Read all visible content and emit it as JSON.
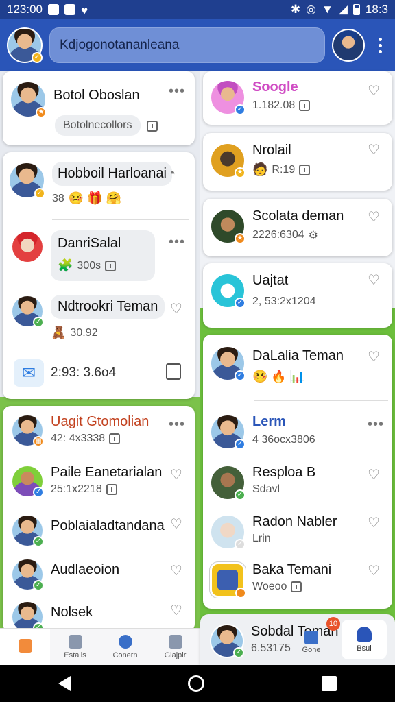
{
  "status_bar": {
    "time": "123:00",
    "clock_right": "18:3"
  },
  "header": {
    "search_text": "Kdjogonotananleana"
  },
  "left_column": {
    "card1": {
      "name": "Botol Oboslan",
      "chip": "Botolnecollors"
    },
    "card2": {
      "items": [
        {
          "name": "Hobboil Harloanai",
          "emojis": "🤒 🎁 🤗",
          "count": "38"
        },
        {
          "name": "DanriSalal",
          "sub": "300s"
        },
        {
          "name": "Ndtrookri Teman",
          "sub": "30.92"
        },
        {
          "name": "2:93: 3.6o4"
        }
      ]
    },
    "card3": {
      "items": [
        {
          "name": "Uagit Gtomolian",
          "sub": "42: 4x3338"
        },
        {
          "name": "Paile Eanetarialan",
          "sub": "25:1x2218"
        },
        {
          "name": "Poblaialadtandana"
        },
        {
          "name": "Audlaeoion"
        },
        {
          "name": "Nolsek"
        }
      ]
    }
  },
  "right_column": {
    "items": [
      {
        "name": "Soogle",
        "sub": "1.182.08"
      },
      {
        "name": "Nrolail",
        "sub": "R:19"
      },
      {
        "name": "Scolata deman",
        "sub": "2226:6304"
      },
      {
        "name": "Uajtat",
        "sub": "2, 53:2x1204"
      },
      {
        "name": "DaLalia Teman",
        "emojis": "🤒 🔥 📊"
      },
      {
        "name": "Lerm",
        "sub": "4 36ocx3806"
      },
      {
        "name": "Resploa B",
        "sub": "Sdavl"
      },
      {
        "name": "Radon Nabler",
        "sub": "Lrin"
      },
      {
        "name": "Baka Temani",
        "sub": "Woeoo"
      },
      {
        "name": "Sobdal Teman",
        "sub": "6.53175",
        "badge": "10"
      }
    ],
    "bottom_tabs": [
      {
        "label": "Gone"
      },
      {
        "label": "Bsul"
      }
    ]
  },
  "tab_bar": {
    "tabs": [
      {
        "label": ""
      },
      {
        "label": "Estalls"
      },
      {
        "label": "Conern"
      },
      {
        "label": "Glajpir"
      }
    ]
  },
  "colors": {
    "header": "#2a55b8",
    "status": "#1f3f8f",
    "accent_orange": "#f28b3b",
    "accent_pink": "#d04dc4"
  }
}
